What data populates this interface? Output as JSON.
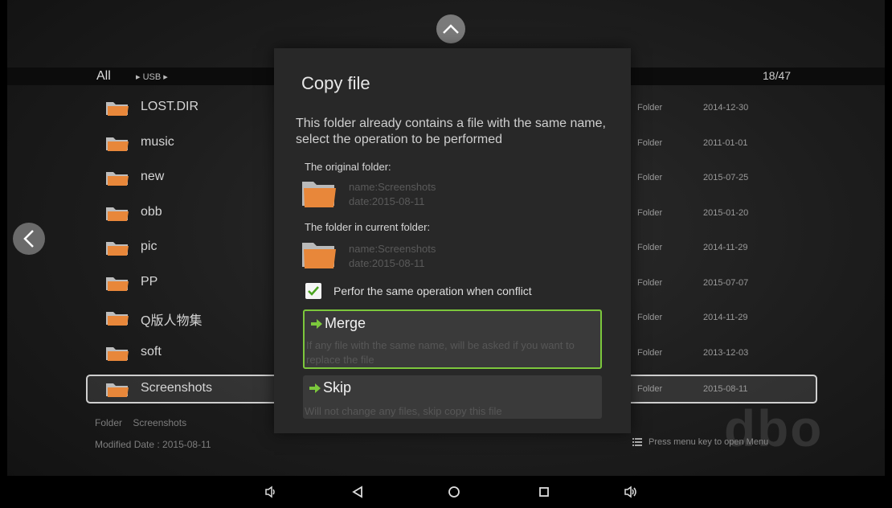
{
  "top": {
    "up_icon": "chevron-up-icon"
  },
  "path": {
    "all_label": "All",
    "usb_label": "USB",
    "counter": "18/47"
  },
  "files": [
    {
      "name": "LOST.DIR",
      "type": "Folder",
      "date": "2014-12-30"
    },
    {
      "name": "music",
      "type": "Folder",
      "date": "2011-01-01"
    },
    {
      "name": "new",
      "type": "Folder",
      "date": "2015-07-25"
    },
    {
      "name": "obb",
      "type": "Folder",
      "date": "2015-01-20"
    },
    {
      "name": "pic",
      "type": "Folder",
      "date": "2014-11-29"
    },
    {
      "name": "PP",
      "type": "Folder",
      "date": "2015-07-07"
    },
    {
      "name": "Q版人物集",
      "type": "Folder",
      "date": "2014-11-29"
    },
    {
      "name": "soft",
      "type": "Folder",
      "date": "2013-12-03"
    },
    {
      "name": "Screenshots",
      "type": "Folder",
      "date": "2015-08-11",
      "selected": true
    }
  ],
  "info": {
    "type_label": "Folder",
    "name": "Screenshots",
    "modified": "Modified Date : 2015-08-11"
  },
  "menu_hint": "Press menu key to open Menu",
  "watermark": "dbo",
  "dialog": {
    "title": "Copy file",
    "message": "This folder already contains a file with the same name, select the operation to be performed",
    "original_label": "The original folder:",
    "original_name": "name:Screenshots",
    "original_date": "date:2015-08-11",
    "current_label": "The folder in current folder:",
    "current_name": "name:Screenshots",
    "current_date": "date:2015-08-11",
    "checkbox_label": "Perfor the same operation when conflict",
    "checkbox_checked": true,
    "merge_title": "Merge",
    "merge_desc": "If any file with the same name, will be asked if you want to replace the file",
    "skip_title": "Skip",
    "skip_desc": "Will not change any files, skip copy this file"
  },
  "colors": {
    "accent_green": "#7cc73c",
    "folder_orange": "#e8873a",
    "background": "#1c1c1c"
  },
  "navbar": [
    "volume-down-icon",
    "back-icon",
    "home-icon",
    "recents-icon",
    "volume-up-icon"
  ]
}
